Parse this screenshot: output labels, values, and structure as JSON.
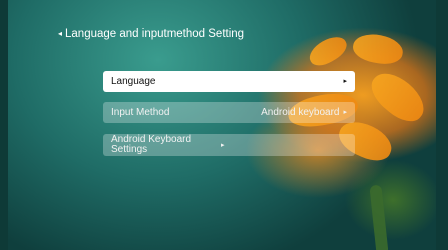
{
  "header": {
    "back_arrow": "◂",
    "title": "Language and inputmethod Setting"
  },
  "menu": {
    "items": [
      {
        "label": "Language",
        "value": "",
        "arrow": "▸"
      },
      {
        "label": "Input Method",
        "value": "Android keyboard",
        "arrow": "▸"
      },
      {
        "label": "Android Keyboard Settings",
        "value": "",
        "arrow": "▸"
      }
    ]
  },
  "colors": {
    "selected_bg": "#ffffff",
    "accent_flower": "#f29418"
  }
}
